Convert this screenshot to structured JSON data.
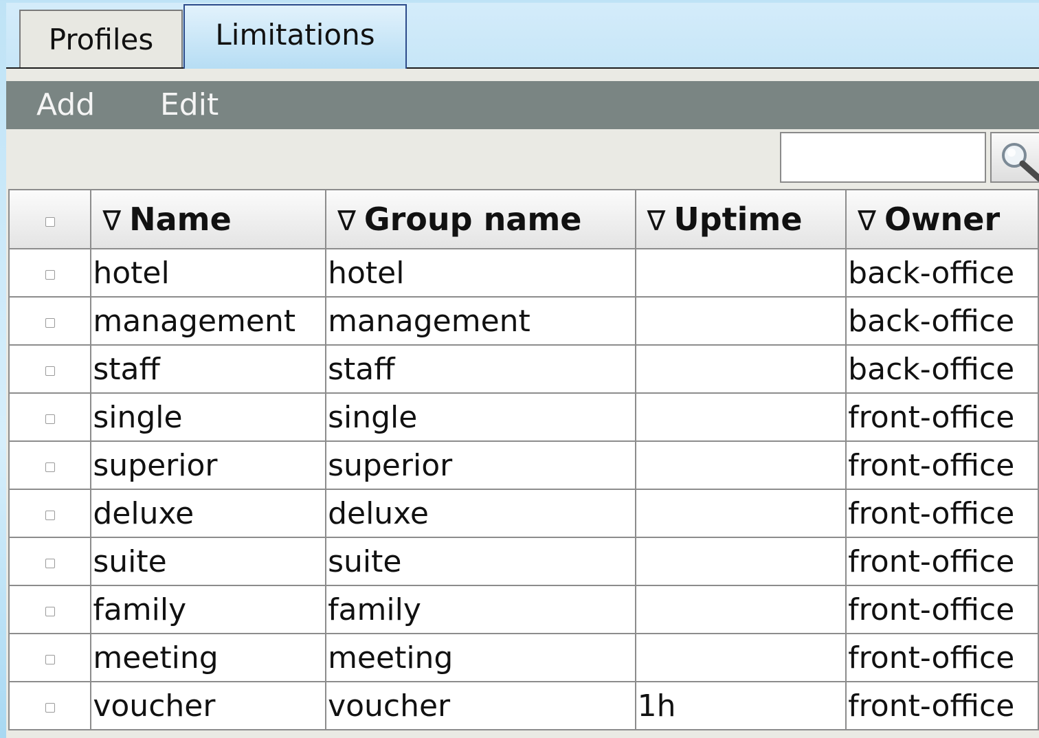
{
  "tabs": [
    {
      "label": "Profiles"
    },
    {
      "label": "Limitations"
    }
  ],
  "active_tab": "Limitations",
  "toolbar": {
    "add_label": "Add",
    "edit_label": "Edit"
  },
  "search": {
    "value": "",
    "placeholder": ""
  },
  "sort_glyph": "∇",
  "columns": [
    {
      "label": "Name"
    },
    {
      "label": "Group name"
    },
    {
      "label": "Uptime"
    },
    {
      "label": "Owner"
    }
  ],
  "rows": [
    {
      "name": "hotel",
      "group": "hotel",
      "uptime": "",
      "owner": "back-office"
    },
    {
      "name": "management",
      "group": "management",
      "uptime": "",
      "owner": "back-office"
    },
    {
      "name": "staff",
      "group": "staff",
      "uptime": "",
      "owner": "back-office"
    },
    {
      "name": "single",
      "group": "single",
      "uptime": "",
      "owner": "front-office"
    },
    {
      "name": "superior",
      "group": "superior",
      "uptime": "",
      "owner": "front-office"
    },
    {
      "name": "deluxe",
      "group": "deluxe",
      "uptime": "",
      "owner": "front-office"
    },
    {
      "name": "suite",
      "group": "suite",
      "uptime": "",
      "owner": "front-office"
    },
    {
      "name": "family",
      "group": "family",
      "uptime": "",
      "owner": "front-office"
    },
    {
      "name": "meeting",
      "group": "meeting",
      "uptime": "",
      "owner": "front-office"
    },
    {
      "name": "voucher",
      "group": "voucher",
      "uptime": "1h",
      "owner": "front-office"
    }
  ],
  "colors": {
    "toolbar_bg": "#7a8583",
    "active_tab_bg": "#b6ddf4",
    "page_bg": "#bfe3f6"
  }
}
